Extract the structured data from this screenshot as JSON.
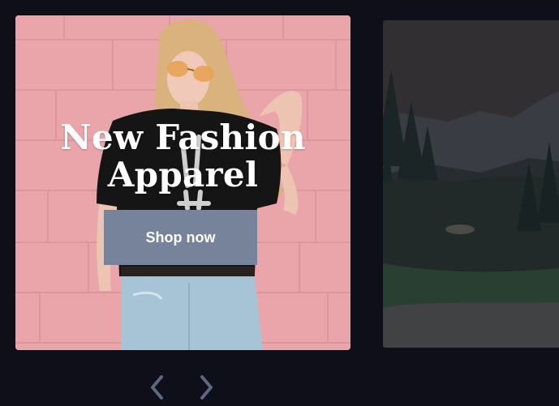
{
  "carousel": {
    "active_slide": {
      "title": "New Fashion Apparel",
      "cta_label": "Shop now",
      "image": "woman-in-sunglasses-photo"
    },
    "next_slide": {
      "image": "mountain-forest-lake-photo"
    },
    "controls": {
      "prev_icon": "chevron-left-icon",
      "next_icon": "chevron-right-icon",
      "arrow_color": "#5a6880"
    }
  },
  "colors": {
    "page_background": "#0f0f19",
    "button_background": "#76839b",
    "button_text": "#ffffff",
    "headline_text": "#ffffff"
  }
}
